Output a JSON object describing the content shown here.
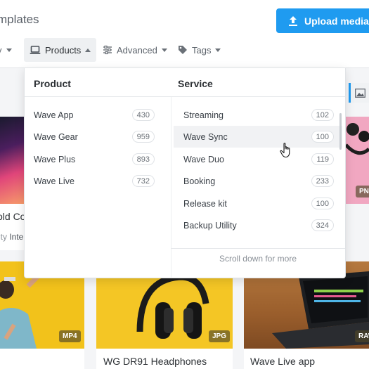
{
  "header": {
    "title_fragment": "mplates",
    "upload_label": "Upload media"
  },
  "filters": {
    "first_fragment": "y",
    "products": "Products",
    "advanced": "Advanced",
    "tags": "Tags"
  },
  "dropdown": {
    "product_heading": "Product",
    "service_heading": "Service",
    "products": [
      {
        "label": "Wave App",
        "count": "430"
      },
      {
        "label": "Wave Gear",
        "count": "959"
      },
      {
        "label": "Wave Plus",
        "count": "893"
      },
      {
        "label": "Wave Live",
        "count": "732"
      }
    ],
    "services": [
      {
        "label": "Streaming",
        "count": "102"
      },
      {
        "label": "Wave Sync",
        "count": "100"
      },
      {
        "label": "Wave Duo",
        "count": "119"
      },
      {
        "label": "Booking",
        "count": "233"
      },
      {
        "label": "Release kit",
        "count": "100"
      },
      {
        "label": "Backup Utility",
        "count": "324"
      }
    ],
    "scroll_hint": "Scroll down for more"
  },
  "cards": {
    "left_title_fragment": "old Co",
    "left_sub_fragment": "ity",
    "left_sub_bold": "Inte",
    "right_badge": "PNG",
    "bottom": [
      {
        "badge": "MP4",
        "title": ""
      },
      {
        "badge": "JPG",
        "title": "WG DR91 Headphones"
      },
      {
        "badge": "RAW",
        "title": "Wave Live app"
      }
    ]
  },
  "colors": {
    "accent": "#1f9bf0",
    "mustard": "#f2c21b"
  }
}
